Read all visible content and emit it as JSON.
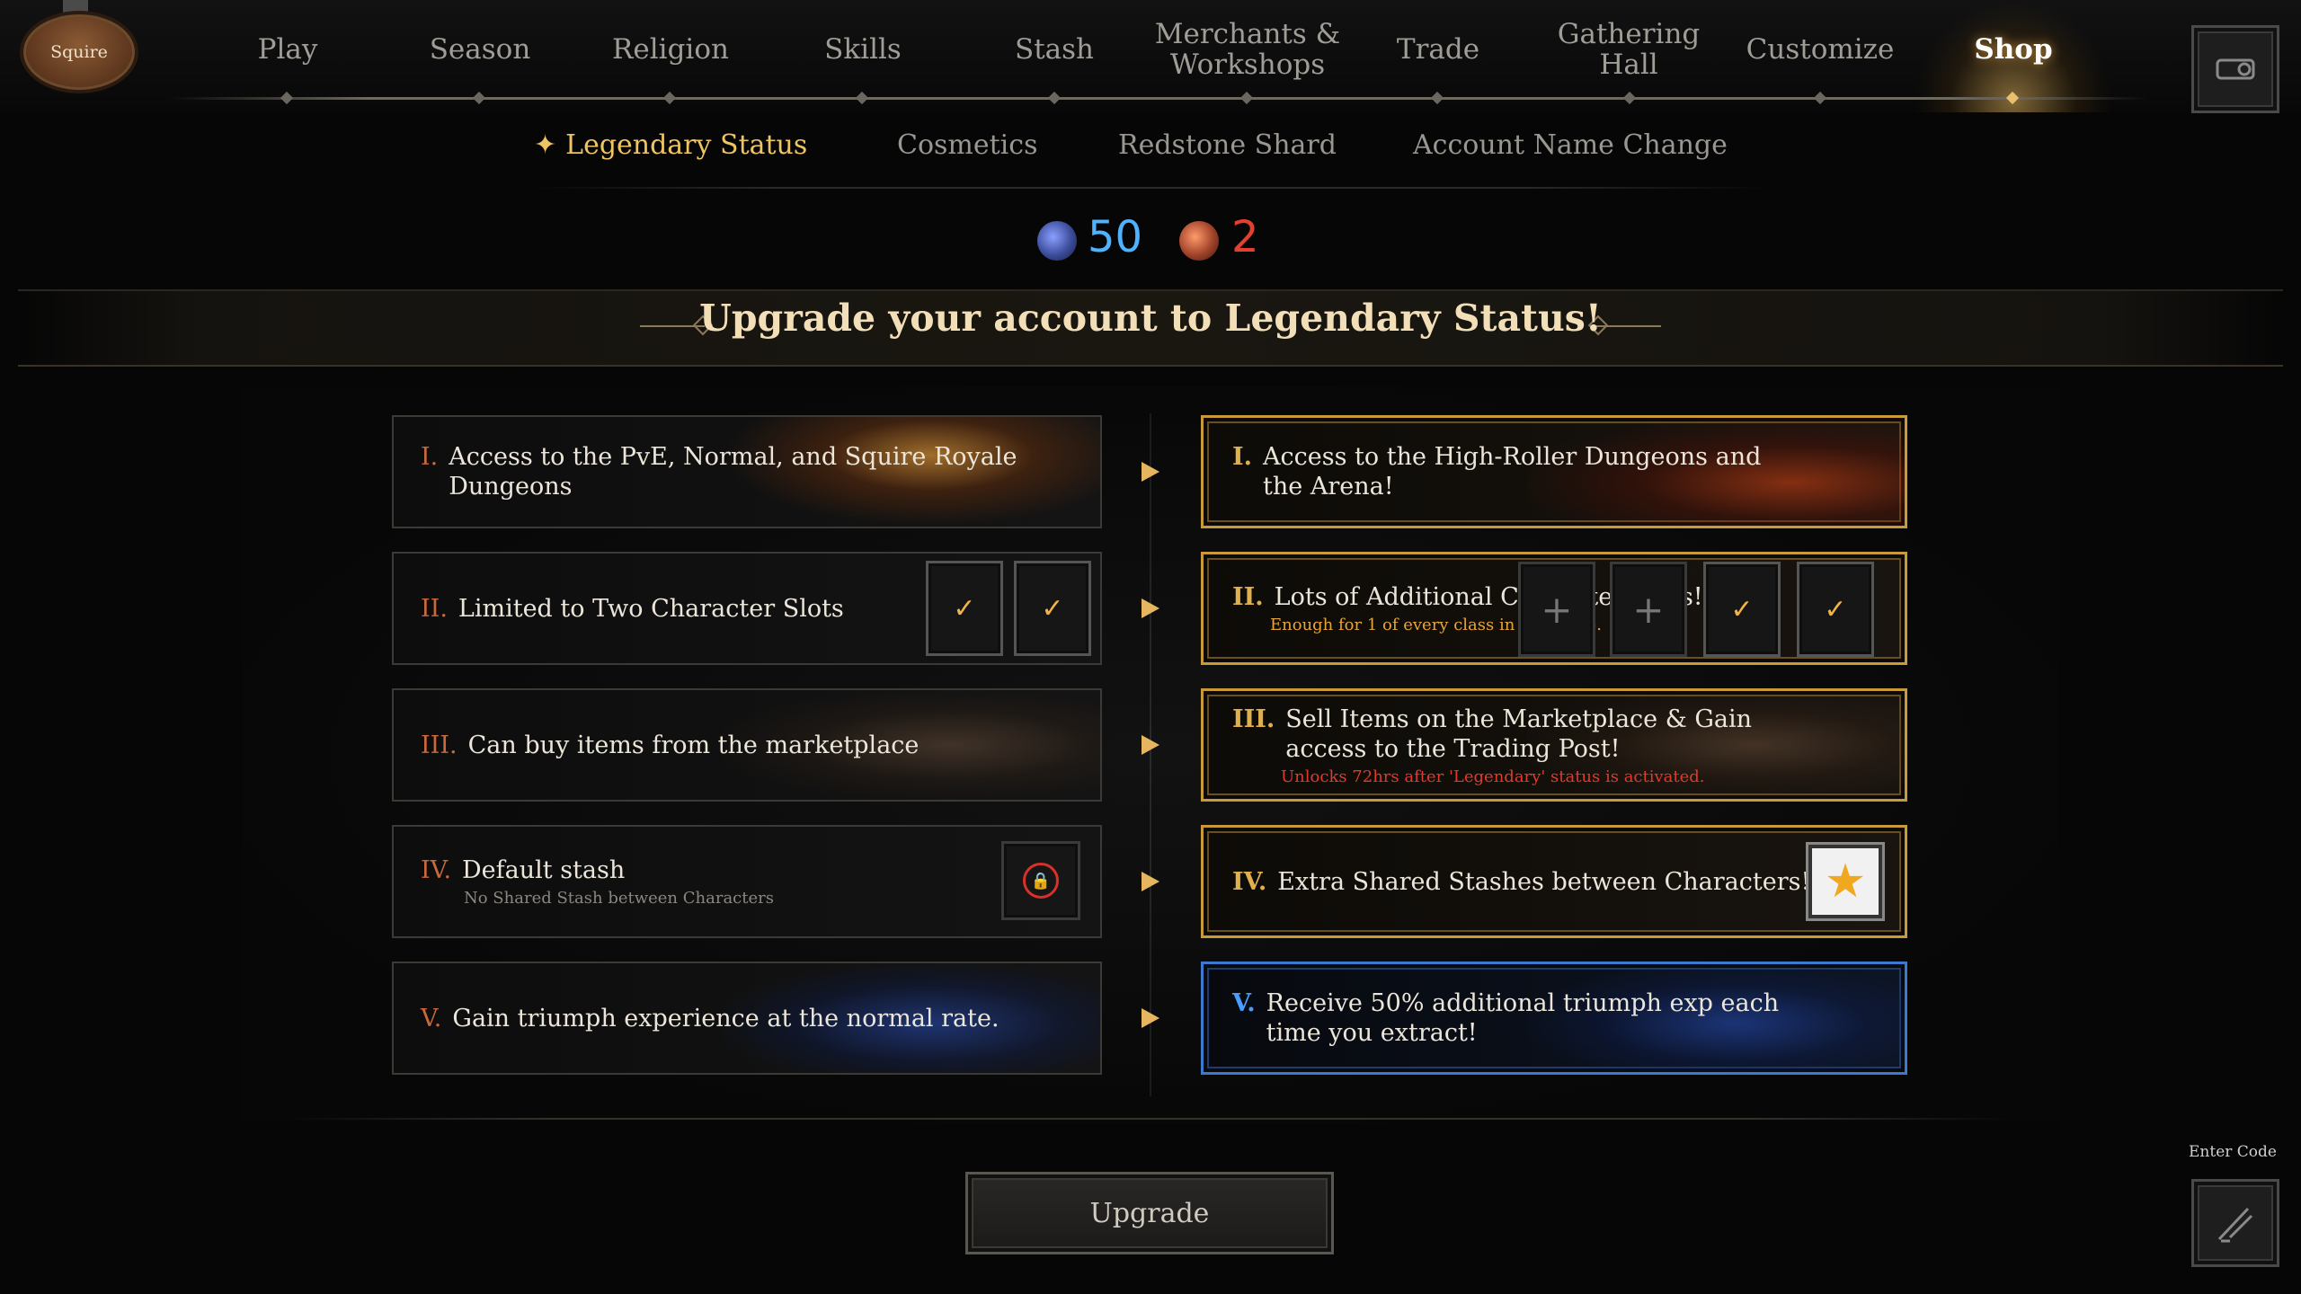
{
  "profile": {
    "badge_label": "Squire"
  },
  "nav": {
    "items": [
      {
        "label": "Play"
      },
      {
        "label": "Season"
      },
      {
        "label": "Religion"
      },
      {
        "label": "Skills"
      },
      {
        "label": "Stash"
      },
      {
        "label": "Merchants & Workshops"
      },
      {
        "label": "Trade"
      },
      {
        "label": "Gathering Hall"
      },
      {
        "label": "Customize"
      },
      {
        "label": "Shop"
      }
    ],
    "active": "Shop"
  },
  "sub_tabs": [
    {
      "label": "Legendary Status",
      "icon": "sparkle-icon"
    },
    {
      "label": "Cosmetics"
    },
    {
      "label": "Redstone Shard"
    },
    {
      "label": "Account Name Change"
    }
  ],
  "currency": {
    "blue_shards": "50",
    "red_shards": "2",
    "blue_color": "#4fb2ff",
    "red_color": "#e5402d"
  },
  "banner": {
    "title": "Upgrade your account to Legendary Status!"
  },
  "comparison": {
    "standard": [
      {
        "numeral": "I.",
        "text": "Access to the PvE, Normal, and Squire Royale Dungeons",
        "sub": ""
      },
      {
        "numeral": "II.",
        "text": "Limited to Two Character Slots",
        "sub": ""
      },
      {
        "numeral": "III.",
        "text": "Can buy items from the marketplace",
        "sub": ""
      },
      {
        "numeral": "IV.",
        "text": "Default stash",
        "sub": "No Shared Stash between Characters"
      },
      {
        "numeral": "V.",
        "text": "Gain triumph experience at the normal rate.",
        "sub": ""
      }
    ],
    "legendary": [
      {
        "numeral": "I.",
        "text": "Access to the High-Roller Dungeons and the Arena!",
        "sub": ""
      },
      {
        "numeral": "II.",
        "text": "Lots of Additional Character Slots!",
        "sub": "Enough for 1 of every class in the game."
      },
      {
        "numeral": "III.",
        "text": "Sell Items on the Marketplace & Gain access to the Trading Post!",
        "sub": "Unlocks 72hrs after 'Legendary' status is activated."
      },
      {
        "numeral": "IV.",
        "text": "Extra Shared Stashes between Characters!",
        "sub": ""
      },
      {
        "numeral": "V.",
        "text": "Receive 50% additional triumph exp each time you extract!",
        "sub": ""
      }
    ]
  },
  "colors": {
    "gold_border": "#c99a3a",
    "blue_border": "#3c7ad0",
    "accent_gold": "#efc563"
  },
  "actions": {
    "upgrade_label": "Upgrade",
    "enter_code_label": "Enter Code"
  }
}
